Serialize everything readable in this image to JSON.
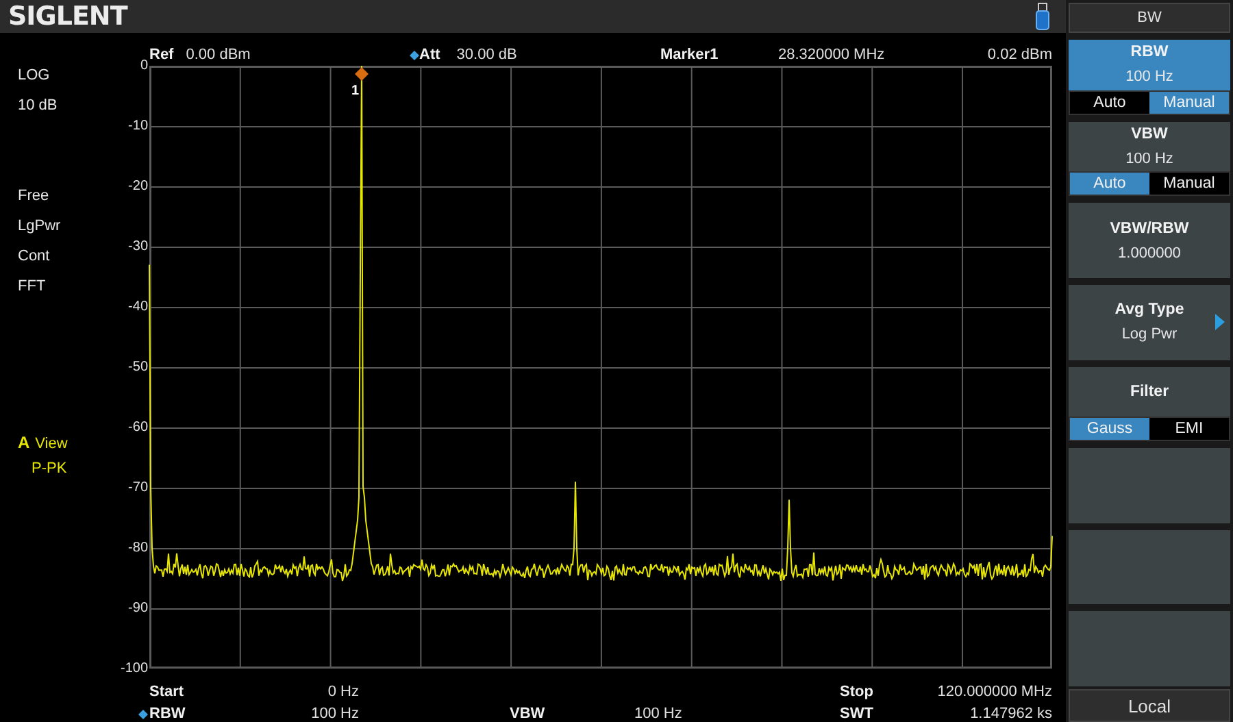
{
  "top_bar": {
    "logo": "SIGLENT"
  },
  "header": {
    "ref_label": "Ref",
    "ref_value": "0.00 dBm",
    "att_label": "Att",
    "att_value": "30.00 dB",
    "marker_label": "Marker1",
    "marker_freq": "28.320000 MHz",
    "marker_level": "0.02 dBm"
  },
  "left_info": {
    "scale": [
      "LOG",
      "10 dB"
    ],
    "modes": [
      "Free",
      "LgPwr",
      "Cont",
      "FFT"
    ],
    "trace": {
      "letter": "A",
      "mode": "View",
      "detector": "P-PK"
    }
  },
  "graph": {
    "y_labels": [
      "0",
      "-10",
      "-20",
      "-30",
      "-40",
      "-50",
      "-60",
      "-70",
      "-80",
      "-90",
      "-100"
    ],
    "marker": {
      "label": "1"
    }
  },
  "footer": {
    "start_label": "Start",
    "start_value": "0 Hz",
    "stop_label": "Stop",
    "stop_value": "120.000000 MHz",
    "rbw_label": "RBW",
    "rbw_value": "100 Hz",
    "vbw_label": "VBW",
    "vbw_value": "100 Hz",
    "swt_label": "SWT",
    "swt_value": "1.147962 ks"
  },
  "softkeys": {
    "title": "BW",
    "keys": [
      {
        "kind": "value",
        "label": "RBW",
        "value": "100 Hz",
        "selected": true,
        "options": [
          {
            "label": "Auto",
            "selected": false
          },
          {
            "label": "Manual",
            "selected": true
          }
        ]
      },
      {
        "kind": "value",
        "label": "VBW",
        "value": "100 Hz",
        "selected": false,
        "options": [
          {
            "label": "Auto",
            "selected": true
          },
          {
            "label": "Manual",
            "selected": false
          }
        ]
      },
      {
        "kind": "value",
        "label": "VBW/RBW",
        "value": "1.000000",
        "selected": false
      },
      {
        "kind": "submenu",
        "label": "Avg Type",
        "value": "Log Pwr",
        "selected": false
      },
      {
        "kind": "value",
        "label": "Filter",
        "selected": false,
        "options": [
          {
            "label": "Gauss",
            "selected": true
          },
          {
            "label": "EMI",
            "selected": false
          }
        ]
      },
      {
        "kind": "empty"
      },
      {
        "kind": "empty"
      },
      {
        "kind": "empty"
      }
    ],
    "status": "Local"
  }
}
